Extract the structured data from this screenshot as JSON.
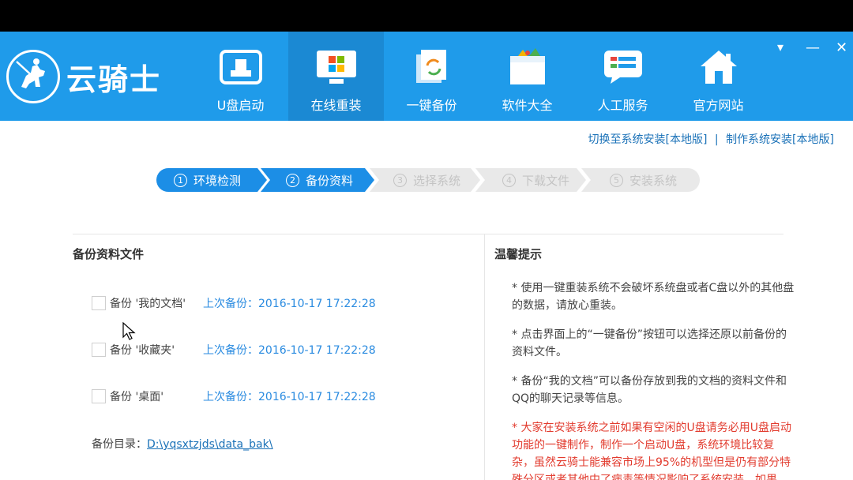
{
  "app": {
    "logo_text": "云骑士",
    "nav": [
      {
        "label": "U盘启动",
        "icon": "usb-drive-icon"
      },
      {
        "label": "在线重装",
        "icon": "windows-monitor-icon"
      },
      {
        "label": "一键备份",
        "icon": "backup-icon"
      },
      {
        "label": "软件大全",
        "icon": "software-box-icon"
      },
      {
        "label": "人工服务",
        "icon": "chat-service-icon"
      },
      {
        "label": "官方网站",
        "icon": "home-icon"
      }
    ],
    "active_nav": "在线重装",
    "window_controls": {
      "menu": "▾",
      "minimize": "—",
      "close": "✕"
    }
  },
  "links": {
    "switch_local": "切换至系统安装[本地版]",
    "separator": "|",
    "make_local": "制作系统安装[本地版]"
  },
  "steps": [
    {
      "num": "1",
      "label": "环境检测",
      "state": "done"
    },
    {
      "num": "2",
      "label": "备份资料",
      "state": "current"
    },
    {
      "num": "3",
      "label": "选择系统",
      "state": "pending"
    },
    {
      "num": "4",
      "label": "下载文件",
      "state": "pending"
    },
    {
      "num": "5",
      "label": "安装系统",
      "state": "pending"
    }
  ],
  "backup": {
    "title": "备份资料文件",
    "items": [
      {
        "name": "备份 '我的文档'",
        "last": "上次备份：2016-10-17 17:22:28",
        "checked": false
      },
      {
        "name": "备份 '收藏夹'",
        "last": "上次备份：2016-10-17 17:22:28",
        "checked": false
      },
      {
        "name": "备份 '桌面'",
        "last": "上次备份：2016-10-17 17:22:28",
        "checked": false
      }
    ],
    "dir_label": "备份目录：",
    "dir_path": "D:\\yqsxtzjds\\data_bak\\"
  },
  "tips": {
    "title": "温馨提示",
    "lines": [
      "* 使用一键重装系统不会破坏系统盘或者C盘以外的其他盘的数据，请放心重装。",
      "* 点击界面上的“一键备份”按钮可以选择还原以前备份的资料文件。",
      "* 备份“我的文档”可以备份存放到我的文档的资料文件和QQ的聊天记录等信息。",
      "* 大家在安装系统之前如果有空闲的U盘请务必用U盘启动功能的一键制作，制作一个启动U盘，系统环境比较复杂，虽然云骑士能兼容市场上95%的机型但是仍有部分特殊分区或者其他中了病毒等情况影响了系统安装，如果"
    ]
  },
  "colors": {
    "header_bg": "#1f9bea",
    "header_active": "#1b89d3",
    "step_active": "#1c8ee6",
    "step_pending": "#e9e9e9",
    "link": "#1b72b8",
    "time": "#2a8be0",
    "warning": "#e23b2e"
  }
}
